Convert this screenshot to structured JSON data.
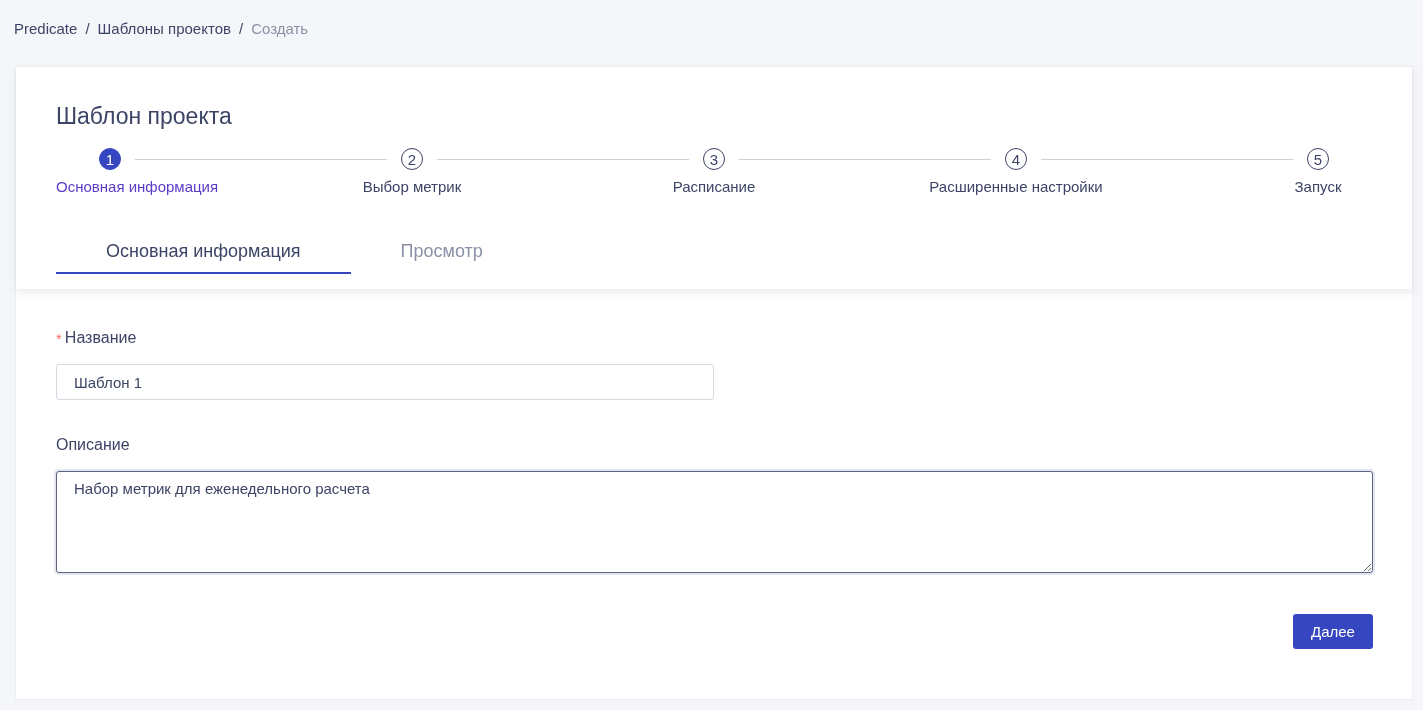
{
  "breadcrumbs": {
    "separator": "/",
    "items": [
      {
        "label": "Predicate",
        "current": false
      },
      {
        "label": "Шаблоны проектов",
        "current": false
      },
      {
        "label": "Создать",
        "current": true
      }
    ]
  },
  "title": "Шаблон проекта",
  "steps": [
    {
      "number": "1",
      "label": "Основная информация",
      "selected": true
    },
    {
      "number": "2",
      "label": "Выбор метрик",
      "selected": false
    },
    {
      "number": "3",
      "label": "Расписание",
      "selected": false
    },
    {
      "number": "4",
      "label": "Расширенные настройки",
      "selected": false
    },
    {
      "number": "5",
      "label": "Запуск",
      "selected": false
    }
  ],
  "tabs": [
    {
      "label": "Основная информация",
      "selected": true
    },
    {
      "label": "Просмотр",
      "selected": false
    }
  ],
  "fields": [
    {
      "kind": "input",
      "label": "Название",
      "required_mark": "*",
      "value": "Шаблон 1"
    },
    {
      "kind": "textarea",
      "label": "Описание",
      "value": "Набор метрик для еженедельного расчета"
    }
  ],
  "buttons": [
    {
      "label": "Далее"
    }
  ]
}
